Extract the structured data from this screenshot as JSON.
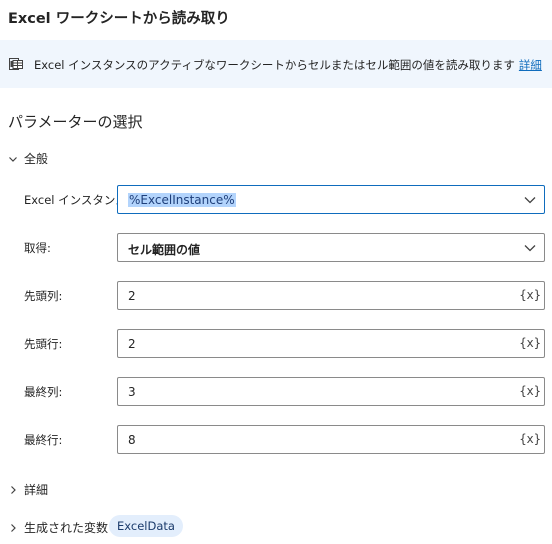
{
  "header": {
    "title": "Excel ワークシートから読み取り"
  },
  "info": {
    "text": "Excel インスタンスのアクティブなワークシートからセルまたはセル範囲の値を読み取ります",
    "link": "詳細"
  },
  "parameters": {
    "title": "パラメーターの選択",
    "general": {
      "label": "全般",
      "fields": [
        {
          "label": "Excel インスタンス:",
          "value": "%ExcelInstance%"
        },
        {
          "label": "取得:",
          "value": "セル範囲の値"
        },
        {
          "label": "先頭列:",
          "value": "2"
        },
        {
          "label": "先頭行:",
          "value": "2"
        },
        {
          "label": "最終列:",
          "value": "3"
        },
        {
          "label": "最終行:",
          "value": "8"
        }
      ]
    },
    "details": {
      "label": "詳細"
    },
    "generated_variables": {
      "label": "生成された変数",
      "chip": "ExcelData"
    }
  },
  "variable_button": "{x}"
}
